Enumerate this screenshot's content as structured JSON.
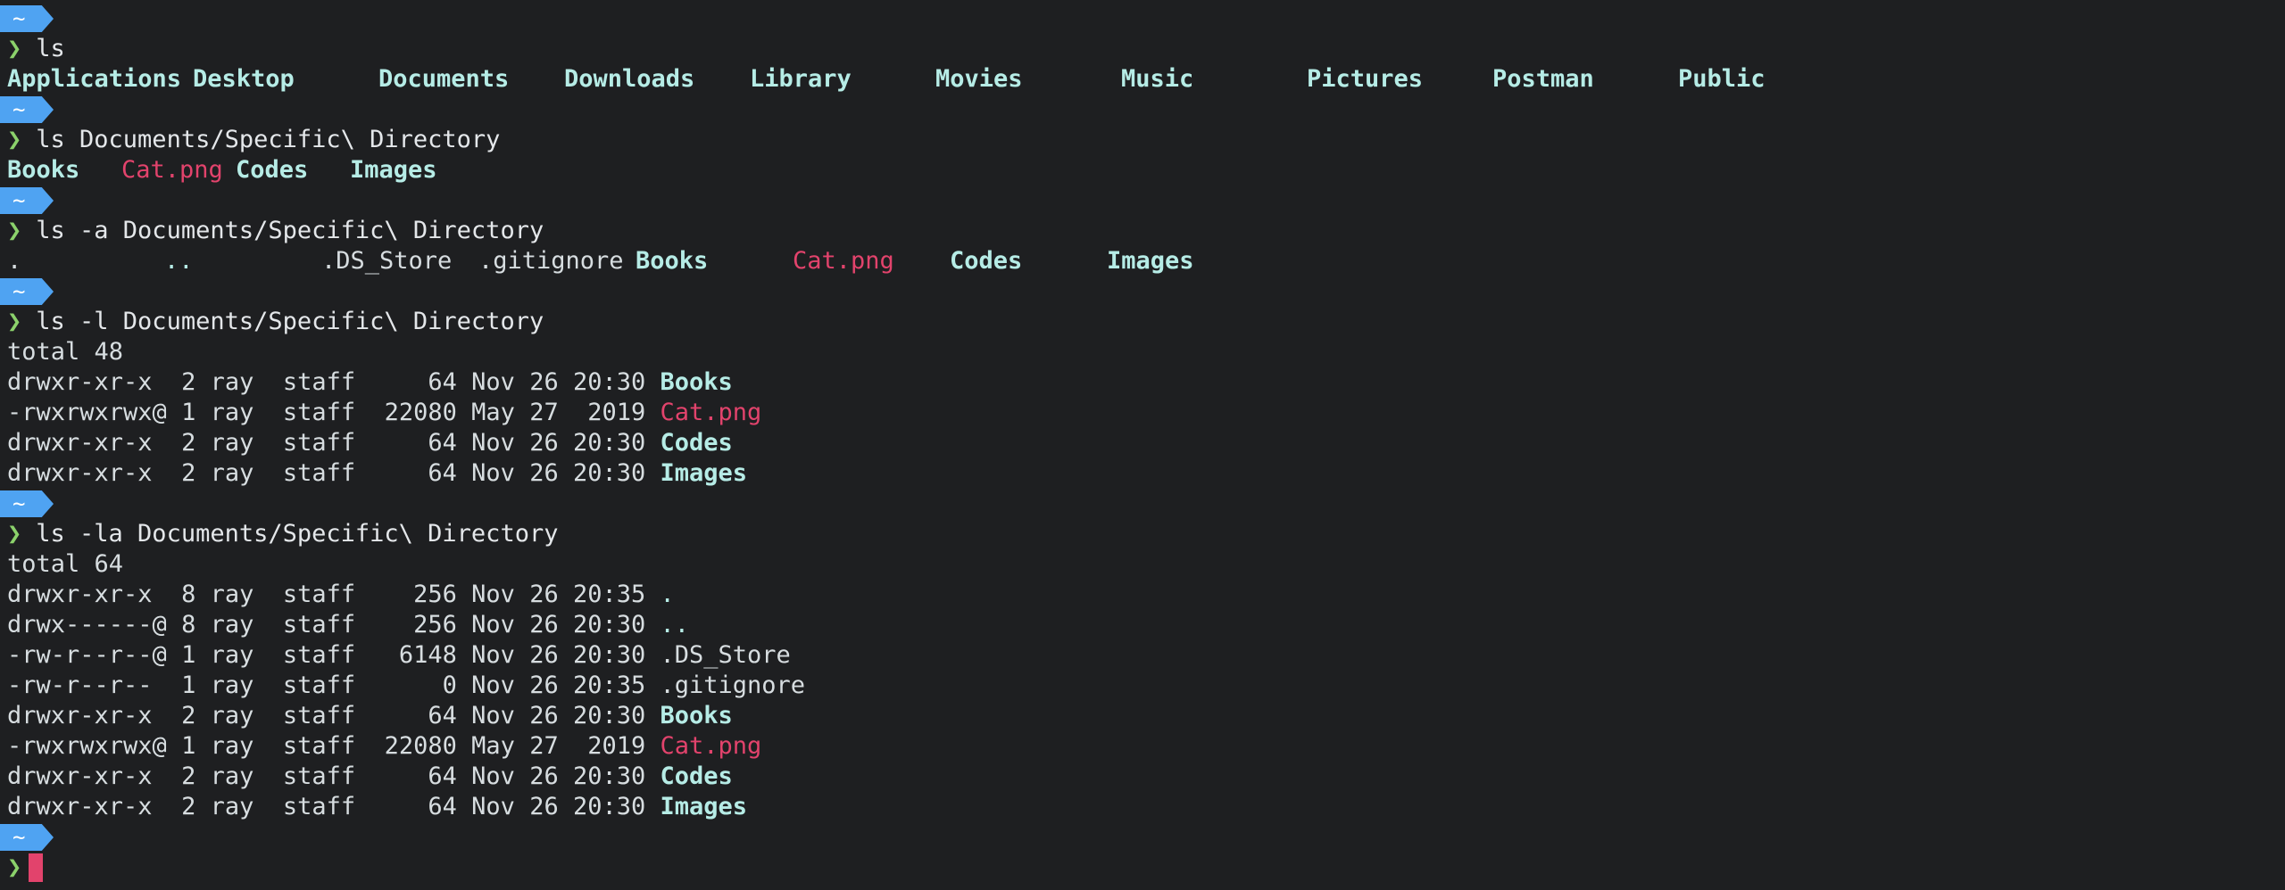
{
  "prompt": {
    "badge": "~",
    "arrow": "❯"
  },
  "commands": {
    "c1": "ls",
    "c2": "ls Documents/Specific\\ Directory",
    "c3": "ls -a Documents/Specific\\ Directory",
    "c4": "ls -l Documents/Specific\\ Directory",
    "c5": "ls -la Documents/Specific\\ Directory"
  },
  "ls_home": [
    "Applications",
    "Desktop",
    "Documents",
    "Downloads",
    "Library",
    "Movies",
    "Music",
    "Pictures",
    "Postman",
    "Public"
  ],
  "ls_dir": [
    "Books",
    "Cat.png",
    "Codes",
    "Images"
  ],
  "ls_a": [
    ".",
    "..",
    ".DS_Store",
    ".gitignore",
    "Books",
    "Cat.png",
    "Codes",
    "Images"
  ],
  "ls_l": {
    "total": "total 48",
    "rows": [
      {
        "meta": "drwxr-xr-x  2 ray  staff     64 Nov 26 20:30 ",
        "name": "Books"
      },
      {
        "meta": "-rwxrwxrwx@ 1 ray  staff  22080 May 27  2019 ",
        "name": "Cat.png"
      },
      {
        "meta": "drwxr-xr-x  2 ray  staff     64 Nov 26 20:30 ",
        "name": "Codes"
      },
      {
        "meta": "drwxr-xr-x  2 ray  staff     64 Nov 26 20:30 ",
        "name": "Images"
      }
    ]
  },
  "ls_la": {
    "total": "total 64",
    "rows": [
      {
        "meta": "drwxr-xr-x  8 ray  staff    256 Nov 26 20:35 ",
        "name": "."
      },
      {
        "meta": "drwx------@ 8 ray  staff    256 Nov 26 20:30 ",
        "name": ".."
      },
      {
        "meta": "-rw-r--r--@ 1 ray  staff   6148 Nov 26 20:30 ",
        "name": ".DS_Store"
      },
      {
        "meta": "-rw-r--r--  1 ray  staff      0 Nov 26 20:35 ",
        "name": ".gitignore"
      },
      {
        "meta": "drwxr-xr-x  2 ray  staff     64 Nov 26 20:30 ",
        "name": "Books"
      },
      {
        "meta": "-rwxrwxrwx@ 1 ray  staff  22080 May 27  2019 ",
        "name": "Cat.png"
      },
      {
        "meta": "drwxr-xr-x  2 ray  staff     64 Nov 26 20:30 ",
        "name": "Codes"
      },
      {
        "meta": "drwxr-xr-x  2 ray  staff     64 Nov 26 20:30 ",
        "name": "Images"
      }
    ]
  },
  "colors": {
    "background": "#1e1f21",
    "badge": "#4fa3f2",
    "arrow": "#8bd16b",
    "directory": "#b6ece6",
    "image_file": "#e2436c",
    "cursor": "#e2436c"
  }
}
